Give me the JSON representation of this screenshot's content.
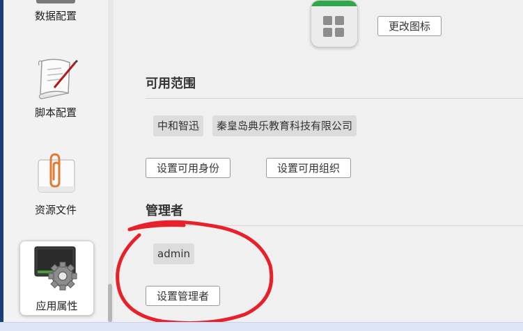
{
  "sidebar": {
    "items": [
      {
        "label": "数据配置",
        "icon": "database-icon"
      },
      {
        "label": "脚本配置",
        "icon": "script-scroll-icon"
      },
      {
        "label": "资源文件",
        "icon": "paperclip-file-icon"
      },
      {
        "label": "应用属性",
        "icon": "app-settings-gear-icon",
        "active": true
      }
    ]
  },
  "main": {
    "change_icon_label": "更改图标",
    "scope": {
      "title": "可用范围",
      "tags": [
        "中和智迅",
        "秦皇岛典乐教育科技有限公司"
      ],
      "set_identity_label": "设置可用身份",
      "set_org_label": "设置可用组织"
    },
    "admins": {
      "title": "管理者",
      "tags": [
        "admin"
      ],
      "set_admin_label": "设置管理者"
    }
  },
  "colors": {
    "annotation_red": "#e8202a",
    "sidebar_accent": "#1f3c7a",
    "icon_green": "#2ea84a"
  }
}
